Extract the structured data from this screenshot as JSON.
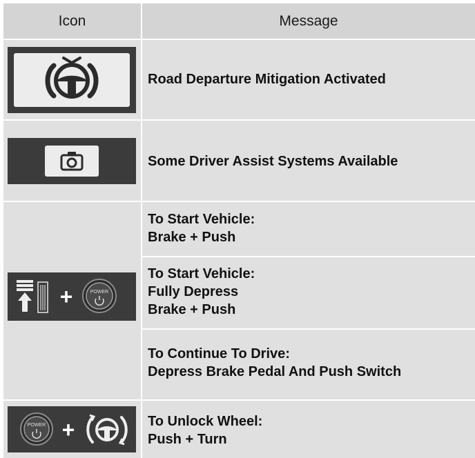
{
  "header": {
    "icon_col": "Icon",
    "message_col": "Message"
  },
  "rows": [
    {
      "icon": "road-departure-steering-icon",
      "message": "Road Departure Mitigation Activated"
    },
    {
      "icon": "camera-icon",
      "message": "Some Driver Assist Systems Available"
    },
    {
      "icon": "brake-pedal-plus-power-button-icon",
      "messages": [
        "To Start Vehicle:\nBrake + Push",
        "To Start Vehicle:\nFully Depress\nBrake + Push",
        "To Continue To Drive:\nDepress Brake Pedal And Push Switch"
      ]
    },
    {
      "icon": "power-button-plus-steering-turn-icon",
      "message": "To Unlock Wheel:\nPush + Turn"
    }
  ],
  "icon_text": {
    "power_label": "POWER",
    "plus": "+"
  },
  "colors": {
    "header_bg": "#d4d4d4",
    "cell_bg": "#e0e0e0",
    "icon_panel": "#3b3b3b"
  }
}
